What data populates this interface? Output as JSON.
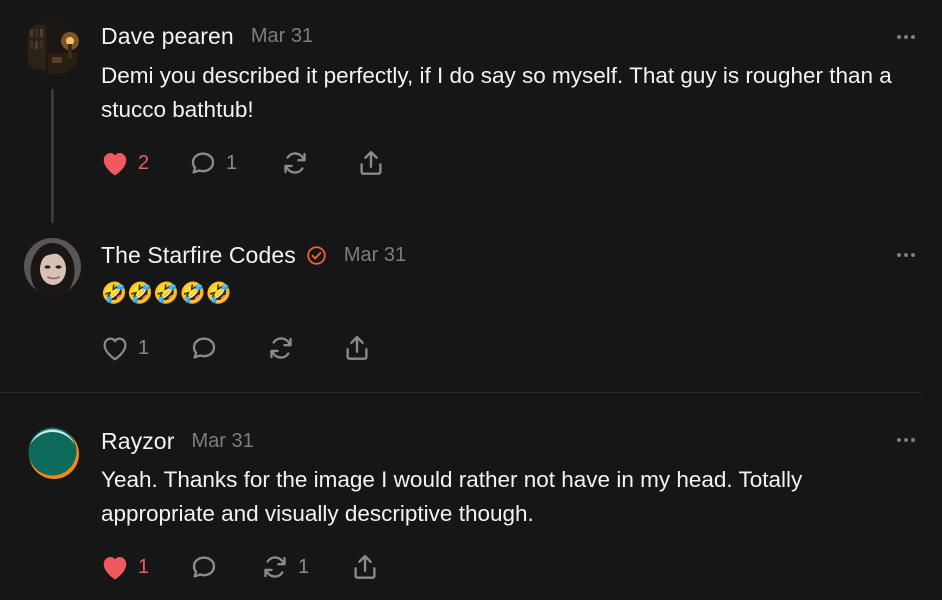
{
  "colors": {
    "background": "#161616",
    "text": "#f3f3f3",
    "muted": "#7d7d7d",
    "like_red": "#ef5a5f",
    "verified_orange": "#f0652b"
  },
  "comments": [
    {
      "author": "Dave pearen",
      "date": "Mar 31",
      "text": "Demi you described it perfectly, if I do say so myself. That guy is rougher than a stucco bathtub!",
      "liked": true,
      "likes": "2",
      "replies": "1",
      "restacks": "",
      "icons": [
        "heart-filled-icon",
        "comment-icon",
        "restack-icon",
        "share-icon",
        "more-icon"
      ]
    },
    {
      "author": "The Starfire Codes",
      "verified": true,
      "date": "Mar 31",
      "text": "🤣🤣🤣🤣🤣",
      "liked": false,
      "likes": "1",
      "replies": "",
      "restacks": "",
      "icons": [
        "heart-outline-icon",
        "comment-icon",
        "restack-icon",
        "share-icon",
        "more-icon"
      ]
    },
    {
      "author": "Rayzor",
      "date": "Mar 31",
      "text": "Yeah. Thanks for the image I would rather not have in my head. Totally appropriate and visually descriptive though.",
      "liked": true,
      "likes": "1",
      "replies": "",
      "restacks": "1",
      "icons": [
        "heart-filled-icon",
        "comment-icon",
        "restack-icon",
        "share-icon",
        "more-icon"
      ]
    }
  ]
}
